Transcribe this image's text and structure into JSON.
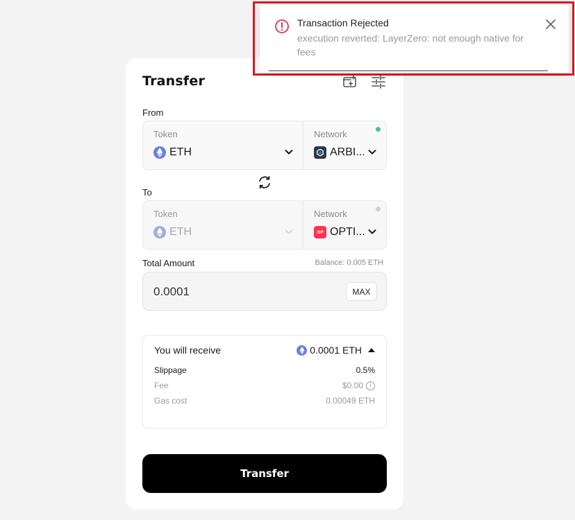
{
  "transfer": {
    "title": "Transfer",
    "from": {
      "label": "From",
      "token_label": "Token",
      "token": "ETH",
      "network_label": "Network",
      "network": "ARBI...",
      "status_color": "#3cc79b"
    },
    "to": {
      "label": "To",
      "token_label": "Token",
      "token": "ETH",
      "network_label": "Network",
      "network": "OPTI...",
      "network_icon_text": "OP",
      "status_color": "#d0d0d0"
    },
    "amount": {
      "label": "Total Amount",
      "balance": "Balance: 0.005 ETH",
      "value": "0.0001",
      "max_label": "MAX"
    },
    "receive": {
      "label": "You will receive",
      "value": "0.0001 ETH",
      "rows": [
        {
          "key": "Slippage",
          "value": "0.5%"
        },
        {
          "key": "Fee",
          "value": "$0.00"
        },
        {
          "key": "Gas cost",
          "value": "0.00049 ETH"
        }
      ]
    },
    "button_label": "Transfer"
  },
  "toast": {
    "title": "Transaction Rejected",
    "message": "execution reverted: LayerZero: not enough native for fees",
    "accent_color": "#e8334a",
    "highlight_color": "#e0141c"
  },
  "icons": {
    "header": [
      "wallet-add-icon",
      "settings-sliders-icon"
    ],
    "swap": "swap-arrows-icon"
  }
}
